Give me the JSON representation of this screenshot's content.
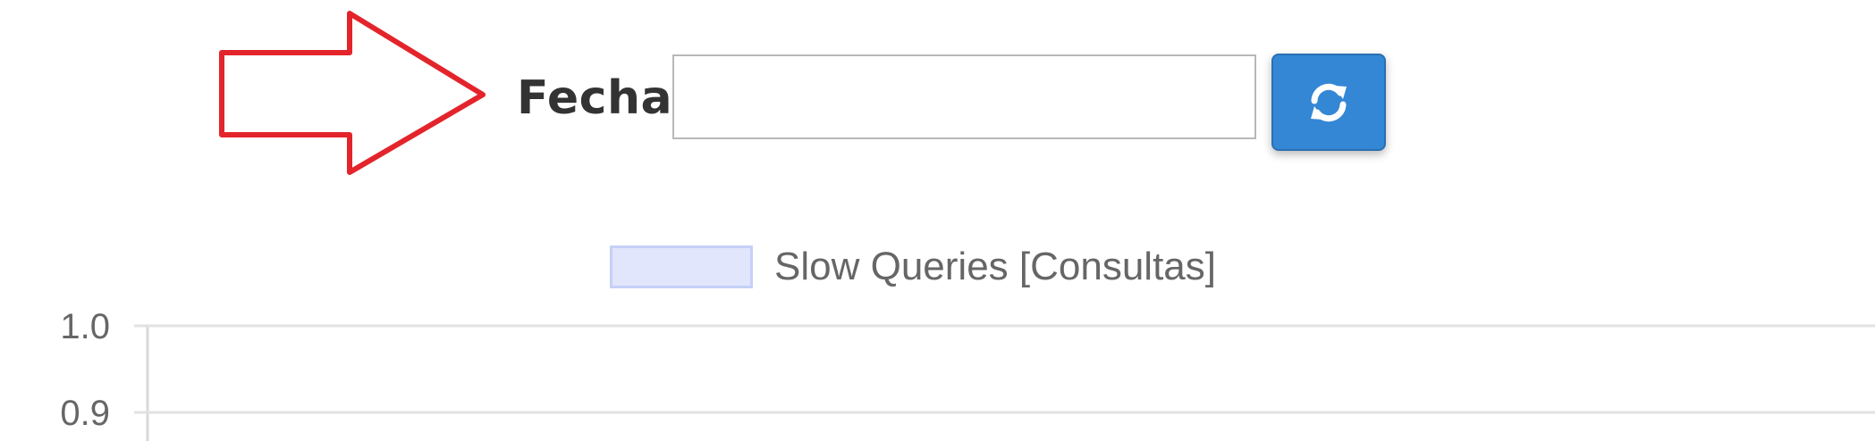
{
  "date_filter": {
    "label": "Fecha",
    "value": "",
    "refresh_icon": "refresh-icon"
  },
  "annotation": {
    "icon": "arrow-right-icon",
    "color": "#e3242b"
  },
  "colors": {
    "button": "#3487d5",
    "legend_fill": "#e1e6fd",
    "legend_border": "#c6d0f7"
  },
  "chart_data": {
    "type": "line",
    "series": [
      {
        "name": "Slow Queries [Consultas]",
        "values": []
      }
    ],
    "y_ticks": [
      "1.0",
      "0.9"
    ],
    "ylim": [
      0,
      1.0
    ],
    "grid": true,
    "legend_position": "top"
  }
}
